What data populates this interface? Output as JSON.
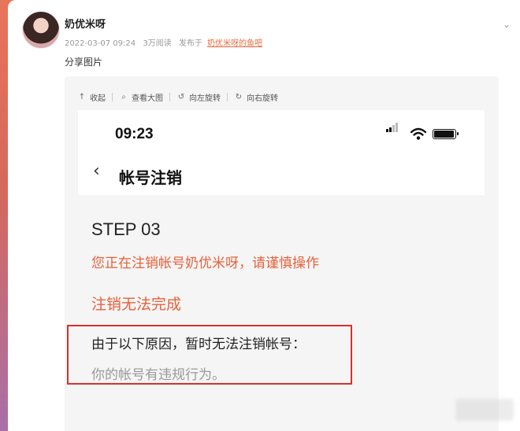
{
  "post": {
    "username": "奶优米呀",
    "date": "2022-03-07 09:24",
    "views": "3万阅读",
    "published_in": "发布于",
    "forum": "奶优米呀的鱼吧",
    "caption": "分享图片"
  },
  "toolbar": {
    "collapse": "收起",
    "view_large": "查看大图",
    "rotate_left": "向左旋转",
    "rotate_right": "向右旋转"
  },
  "screenshot": {
    "time": "09:23",
    "nav_title": "帐号注销",
    "step": "STEP 03",
    "warning": "您正在注销帐号奶优米呀，请谨慎操作",
    "cannot_complete": "注销无法完成",
    "reason_header": "由于以下原因，暂时无法注销帐号：",
    "reason_detail": "你的帐号有违规行为。"
  },
  "colors": {
    "accent_orange": "#e8603a",
    "highlight_red": "#d9302c",
    "link_orange": "#e86a3e"
  },
  "icons": [
    "chevron-down-icon",
    "collapse-icon",
    "search-icon",
    "rotate-left-icon",
    "rotate-right-icon",
    "signal-icon",
    "wifi-icon",
    "battery-icon",
    "back-arrow-icon"
  ]
}
